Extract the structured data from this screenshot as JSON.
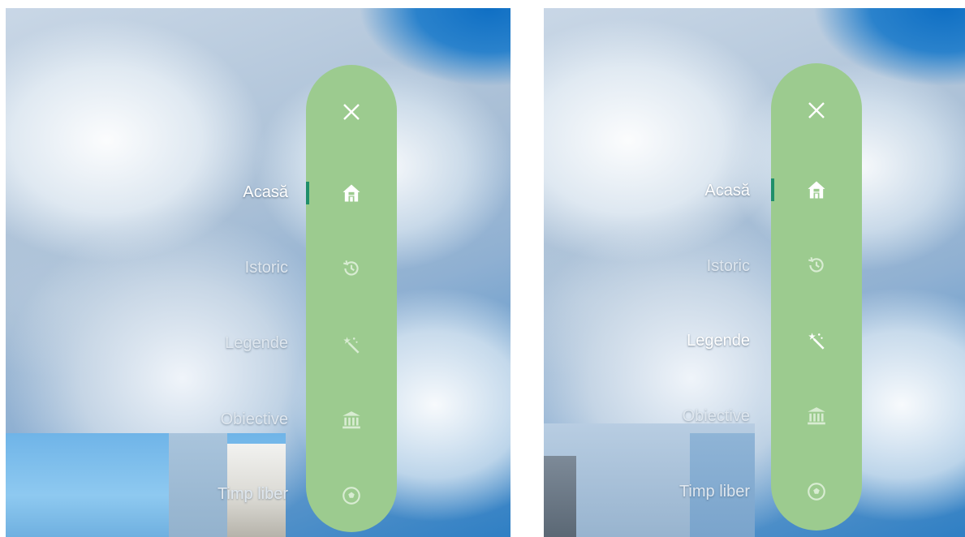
{
  "colors": {
    "pill_background": "#9ccb8f",
    "active_indicator": "#1f8f6a",
    "icon_active": "#ffffff",
    "icon_inactive": "#d8ecd2"
  },
  "panels": [
    {
      "menu": {
        "close_icon": "close-icon",
        "active_item": "Acasă",
        "items": [
          {
            "label": "Acasă",
            "icon": "home-icon"
          },
          {
            "label": "Istoric",
            "icon": "history-icon"
          },
          {
            "label": "Legende",
            "icon": "magic-wand-icon"
          },
          {
            "label": "Obiective",
            "icon": "museum-icon"
          },
          {
            "label": "Timp liber",
            "icon": "soccer-ball-icon"
          }
        ]
      }
    },
    {
      "menu": {
        "close_icon": "close-icon",
        "active_item": "Acasă",
        "items": [
          {
            "label": "Acasă",
            "icon": "home-icon"
          },
          {
            "label": "Istoric",
            "icon": "history-icon"
          },
          {
            "label": "Legende",
            "icon": "magic-wand-icon"
          },
          {
            "label": "Obiective",
            "icon": "museum-icon"
          },
          {
            "label": "Timp liber",
            "icon": "soccer-ball-icon"
          }
        ]
      }
    }
  ]
}
